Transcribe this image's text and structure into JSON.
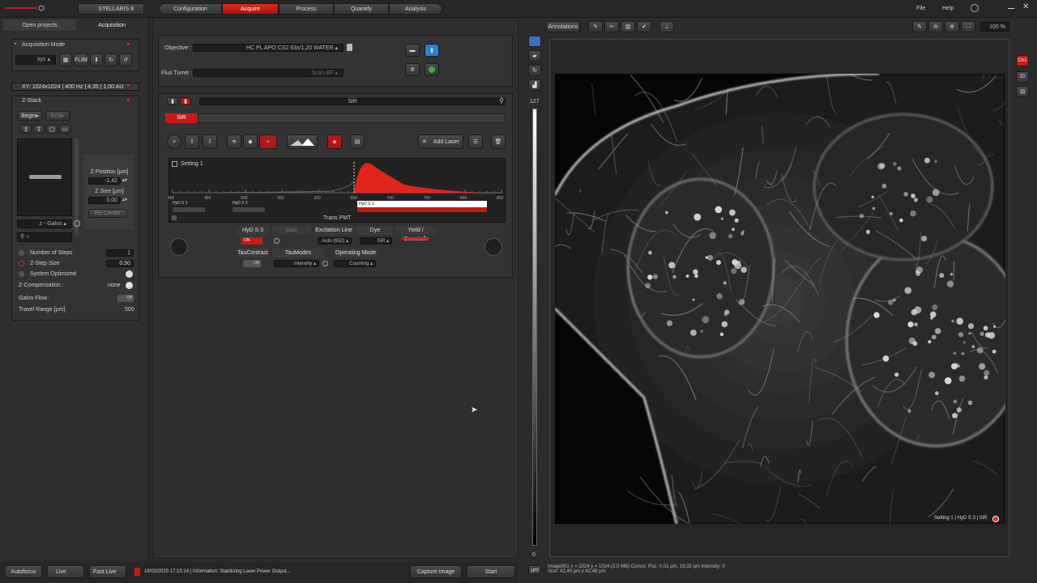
{
  "topbar": {
    "instrument": "STELLARIS 8",
    "workflow_tabs": [
      "Configuration",
      "Acquire",
      "Process",
      "Quantify",
      "Analysis"
    ],
    "active_tab": "Acquire",
    "menu": [
      "File",
      "Help"
    ]
  },
  "left_panel": {
    "tabs": [
      "Open projects",
      "Acquisition"
    ],
    "acquisition_mode": {
      "title": "Acquisition Mode",
      "mode": "xyz",
      "flim_label": "FLIM"
    },
    "xy_summary": "XY: 1024x1024 | 400 Hz | 4,35 | 1,00 AU",
    "zstack": {
      "title": "Z-Stack",
      "begin": "Begin",
      "end": "End",
      "z_position_label": "Z Position [µm]",
      "z_position_value": "-1,42",
      "z_size_label": "Z Size [µm]",
      "z_size_value": "0,00",
      "recenter": "Re-Center",
      "drive": "z - Galvo"
    },
    "params": [
      {
        "label": "Number of Steps",
        "value": "1"
      },
      {
        "label": "Z-Step Size",
        "value": "0,50"
      },
      {
        "label": "System Optimized",
        "value": ""
      },
      {
        "label": "Z-Compensation :",
        "value": "none"
      },
      {
        "label": "Galvo Flow :",
        "value": "Off"
      },
      {
        "label": "Travel Range [µm]",
        "value": "500"
      }
    ]
  },
  "objective": {
    "label": "Objective :",
    "value": "HC PL APO CS2   63x/1,20 WATER",
    "fluo_label": "Fluo Turret :",
    "fluo_value": "Scan-BF"
  },
  "setting": {
    "search_text": "SiR",
    "dye_chip": "SiR",
    "add_laser": "Add Laser",
    "spectrum_title": "Setting 1",
    "ticks": [
      "400",
      "450",
      "500",
      "550",
      "600",
      "650",
      "700",
      "750",
      "800",
      "850"
    ],
    "detectors": [
      "HyD S 1",
      "HyD X 2",
      "HyD S 3"
    ],
    "trans_label": "Trans PMT"
  },
  "detector_table": {
    "headers": [
      "HyD S 3",
      "Gain",
      "Excitation Line",
      "Dye",
      "Yield / Crosstalk"
    ],
    "on_label": "ON",
    "excitation": "Auto (652)",
    "dye": "SiR",
    "row2_headers": [
      "TauContrast",
      "TauModes",
      "Operating Mode"
    ],
    "tau_contrast": "Off",
    "tau_mode": "Intensity",
    "operating_mode": "Counting"
  },
  "viewer": {
    "annotations": "Annotations",
    "zoom": "100 %",
    "scale_top": "127",
    "scale_bottom": "0",
    "image_caption": "Setting 1 | HyD S 3 | SiR",
    "side_buttons": [
      "Ch1",
      "3D"
    ],
    "status_line1": "Image001    x = 1024 y = 1024 (2,0 MB)  Cursor:  Pos: 0,01 µm, 19,32 µm   Intensity: 0",
    "status_line2": "Size: 42,49 µm x 42,49 µm",
    "unit": "µm"
  },
  "bottombar": {
    "autofocus": "Autofocus",
    "live": "Live",
    "fast_live": "Fast Live",
    "message": "18/03/2020 17:15:14 | Information: Stabilizing Laser Power Output...",
    "capture": "Capture Image",
    "start": "Start"
  },
  "colors": {
    "accent": "#e3241b",
    "panel": "#333333",
    "bg": "#2b2b2b"
  }
}
